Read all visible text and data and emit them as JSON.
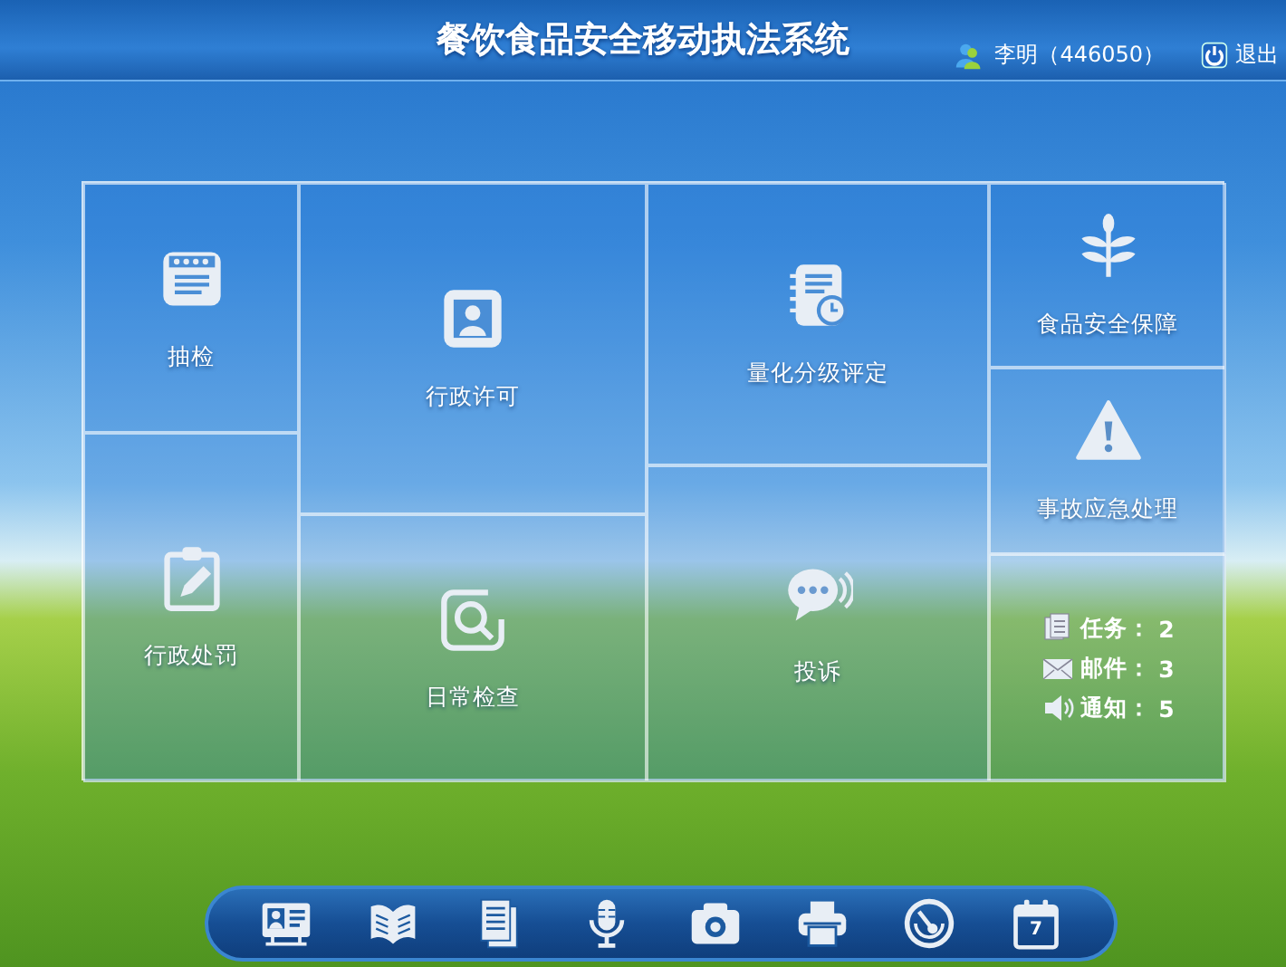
{
  "header": {
    "title": "餐饮食品安全移动执法系统",
    "user": "李明（446050）",
    "logout": "退出"
  },
  "tiles": [
    {
      "label": "抽检"
    },
    {
      "label": "行政处罚"
    },
    {
      "label": "行政许可"
    },
    {
      "label": "日常检查"
    },
    {
      "label": "量化分级评定"
    },
    {
      "label": "投诉"
    },
    {
      "label": "食品安全保障"
    },
    {
      "label": "事故应急处理"
    }
  ],
  "summary": [
    {
      "kind": "tasks",
      "label": "任务：",
      "count": "2"
    },
    {
      "kind": "mail",
      "label": "邮件：",
      "count": "3"
    },
    {
      "kind": "notice",
      "label": "通知：",
      "count": "5"
    }
  ],
  "dock": {
    "calendar_day": "7"
  }
}
